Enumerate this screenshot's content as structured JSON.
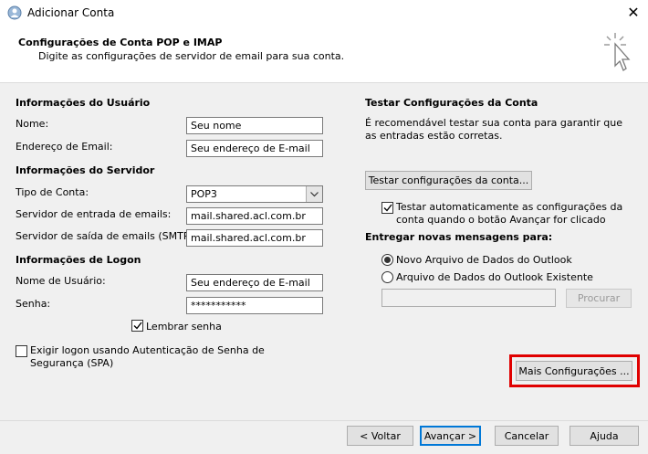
{
  "window": {
    "title": "Adicionar Conta",
    "close_glyph": "✕",
    "app_icon": "outlook-account-icon"
  },
  "header": {
    "title": "Configurações de Conta POP e IMAP",
    "subtitle": "Digite as configurações de servidor de email para sua conta.",
    "icon": "cursor-click-icon"
  },
  "user_info": {
    "heading": "Informações do Usuário",
    "name_label": "Nome:",
    "name_value": "Seu nome",
    "email_label": "Endereço de Email:",
    "email_value": "Seu endereço de E-mail"
  },
  "server_info": {
    "heading": "Informações do Servidor",
    "account_type_label": "Tipo de Conta:",
    "account_type_value": "POP3",
    "incoming_label": "Servidor de entrada de emails:",
    "incoming_value": "mail.shared.acl.com.br",
    "outgoing_label": "Servidor de saída de emails (SMTP):",
    "outgoing_value": "mail.shared.acl.com.br"
  },
  "logon_info": {
    "heading": "Informações de Logon",
    "username_label": "Nome de Usuário:",
    "username_value": "Seu endereço de E-mail",
    "password_label": "Senha:",
    "password_value": "***********",
    "remember_label": "Lembrar senha",
    "remember_checked": true,
    "spa_label": "Exigir logon usando Autenticação de Senha de Segurança (SPA)",
    "spa_checked": false
  },
  "test_settings": {
    "heading": "Testar Configurações da Conta",
    "description": "É recomendável testar sua conta para garantir que as entradas estão corretas.",
    "test_button": "Testar configurações da conta...",
    "auto_test_label": "Testar automaticamente as configurações da conta quando o botão Avançar for clicado",
    "auto_test_checked": true
  },
  "delivery": {
    "heading": "Entregar novas mensagens para:",
    "option_new": "Novo Arquivo de Dados do Outlook",
    "option_existing": "Arquivo de Dados do Outlook Existente",
    "selected": "new",
    "browse_button": "Procurar"
  },
  "more_settings_button": "Mais Configurações ...",
  "footer": {
    "back": "< Voltar",
    "next": "Avançar >",
    "cancel": "Cancelar",
    "help": "Ajuda"
  },
  "colors": {
    "highlight": "#e00000",
    "focus": "#0078d7"
  }
}
